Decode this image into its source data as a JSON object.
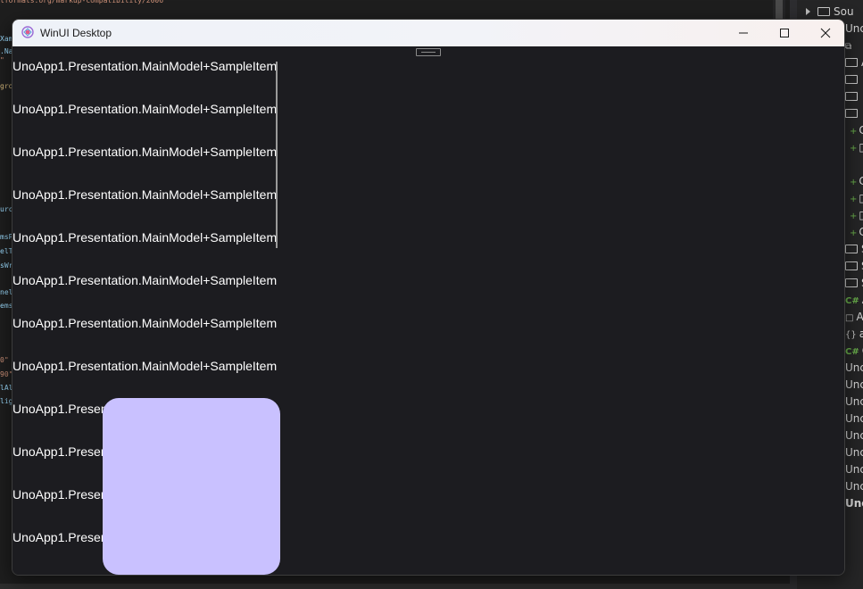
{
  "ide": {
    "code_lines": [
      {
        "text": "tformats.org/markup-compatibility/2006\"",
        "cls": "c-orange"
      },
      {
        "text": "Xam",
        "cls": "c-light"
      },
      {
        "text": ".Na",
        "cls": "c-light"
      },
      {
        "text": "\"",
        "cls": "c-orange"
      },
      {
        "text": "gro",
        "cls": "c-yellow"
      },
      {
        "text": "urc",
        "cls": "c-light"
      },
      {
        "text": "msP",
        "cls": "c-light"
      },
      {
        "text": "elT",
        "cls": "c-light"
      },
      {
        "text": "sWr",
        "cls": "c-light"
      },
      {
        "text": "nel",
        "cls": "c-light"
      },
      {
        "text": "ems",
        "cls": "c-light"
      },
      {
        "text": "0\"",
        "cls": "c-orange"
      },
      {
        "text": "90\"",
        "cls": "c-orange"
      },
      {
        "text": "lAl",
        "cls": "c-light"
      },
      {
        "text": "lig",
        "cls": "c-light"
      }
    ],
    "solution_explorer": [
      {
        "kind": "folder",
        "text": "Sou",
        "chevron": true
      },
      {
        "kind": "text",
        "text": "Unc"
      },
      {
        "kind": "glyph",
        "glyph": "⧉",
        "text": ""
      },
      {
        "kind": "folder",
        "text": "A"
      },
      {
        "kind": "folder",
        "text": ""
      },
      {
        "kind": "folder",
        "text": ""
      },
      {
        "kind": "folder",
        "text": ""
      },
      {
        "kind": "plus",
        "text": "C"
      },
      {
        "kind": "plus",
        "text": "▯"
      },
      {
        "kind": "plus",
        "text": "C"
      },
      {
        "kind": "plus",
        "text": "▯"
      },
      {
        "kind": "plus",
        "text": "▯"
      },
      {
        "kind": "plus",
        "text": "C"
      },
      {
        "kind": "folder",
        "text": "S"
      },
      {
        "kind": "folder",
        "text": "S"
      },
      {
        "kind": "folder",
        "text": "S"
      },
      {
        "kind": "csharp",
        "text": "A"
      },
      {
        "kind": "glyph",
        "glyph": "□",
        "text": "A"
      },
      {
        "kind": "glyph",
        "glyph": "{}",
        "text": "a"
      },
      {
        "kind": "csharp",
        "text": "C"
      },
      {
        "kind": "text",
        "text": "Unc"
      },
      {
        "kind": "text",
        "text": "Unc"
      },
      {
        "kind": "text",
        "text": "Unc"
      },
      {
        "kind": "text",
        "text": "Unc"
      },
      {
        "kind": "text",
        "text": "Unc"
      },
      {
        "kind": "text",
        "text": "Unc"
      },
      {
        "kind": "text",
        "text": "Unc"
      },
      {
        "kind": "text",
        "text": "Unc"
      },
      {
        "kind": "text",
        "text": "Unc",
        "bold": true
      }
    ]
  },
  "window": {
    "title": "WinUI Desktop",
    "icon": "uno-app-icon",
    "caption_buttons": [
      "minimize-icon",
      "maximize-icon",
      "close-icon"
    ]
  },
  "list": {
    "items": [
      "UnoApp1.Presentation.MainModel+SampleItem",
      "UnoApp1.Presentation.MainModel+SampleItem",
      "UnoApp1.Presentation.MainModel+SampleItem",
      "UnoApp1.Presentation.MainModel+SampleItem",
      "UnoApp1.Presentation.MainModel+SampleItem",
      "UnoApp1.Presentation.MainModel+SampleItem",
      "UnoApp1.Presentation.MainModel+SampleItem",
      "UnoApp1.Presentation.MainModel+SampleItem",
      "UnoApp1.Presen",
      "UnoApp1.Presen",
      "UnoApp1.Presen",
      "UnoApp1.Presen"
    ]
  },
  "colors": {
    "overlay": "#c9c1ff",
    "window_bg": "#1c1c20"
  }
}
